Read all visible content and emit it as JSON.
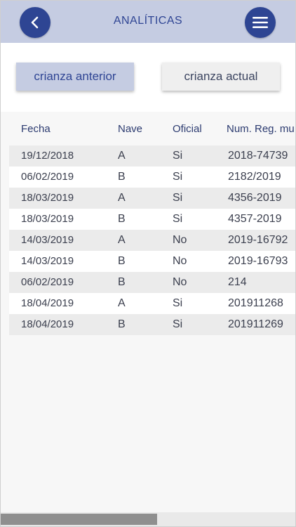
{
  "header": {
    "title": "ANALÍTICAS",
    "back_icon": "chevron-left-icon",
    "menu_icon": "hamburger-menu-icon",
    "color_bar": "#c5cce2",
    "color_button": "#2e4593"
  },
  "toggle": {
    "previous_label": "crianza anterior",
    "current_label": "crianza actual",
    "selected": "previous"
  },
  "table": {
    "headers": {
      "fecha": "Fecha",
      "nave": "Nave",
      "oficial": "Oficial",
      "num": "Num. Reg. mu"
    },
    "rows": [
      {
        "fecha": "19/12/2018",
        "nave": "A",
        "oficial": "Si",
        "num": "2018-74739"
      },
      {
        "fecha": "06/02/2019",
        "nave": "B",
        "oficial": "Si",
        "num": "2182/2019"
      },
      {
        "fecha": "18/03/2019",
        "nave": "A",
        "oficial": "Si",
        "num": "4356-2019"
      },
      {
        "fecha": "18/03/2019",
        "nave": "B",
        "oficial": "Si",
        "num": "4357-2019"
      },
      {
        "fecha": "14/03/2019",
        "nave": "A",
        "oficial": "No",
        "num": "2019-16792"
      },
      {
        "fecha": "14/03/2019",
        "nave": "B",
        "oficial": "No",
        "num": "2019-16793"
      },
      {
        "fecha": "06/02/2019",
        "nave": "B",
        "oficial": "No",
        "num": "214"
      },
      {
        "fecha": "18/04/2019",
        "nave": "A",
        "oficial": "Si",
        "num": "201911268"
      },
      {
        "fecha": "18/04/2019",
        "nave": "B",
        "oficial": "Si",
        "num": "201911269"
      }
    ]
  },
  "scroll": {
    "horizontal_position_fraction": 0.0,
    "horizontal_visible_fraction": 0.53
  }
}
